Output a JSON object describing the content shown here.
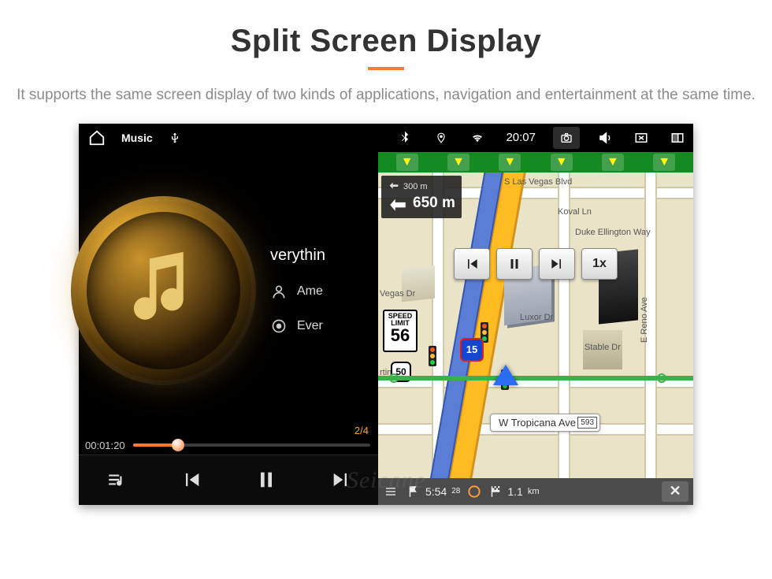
{
  "header": {
    "title": "Split Screen Display",
    "subtitle": "It supports the same screen display of two kinds of applications, navigation and entertainment at the same time."
  },
  "statusbar": {
    "app_title": "Music",
    "time": "20:07",
    "icons": {
      "home": "home-icon",
      "usb": "usb-icon",
      "bluetooth": "bluetooth-icon",
      "location": "location-icon",
      "wifi": "wifi-icon",
      "camera": "camera-icon",
      "volume": "volume-icon",
      "close_app": "close-app-icon",
      "split": "split-screen-icon"
    }
  },
  "music": {
    "track_title": "verythin",
    "artist": "Ame",
    "album": "Ever",
    "track_index": "2/4",
    "elapsed": "00:01:20",
    "controls": {
      "playlist": "♪",
      "prev": "⏮",
      "pause": "⏸",
      "next": "⏭"
    }
  },
  "navigation": {
    "turn_hint": {
      "primary_distance": "650 m",
      "secondary_distance": "300 m"
    },
    "speed_limit": {
      "label": "SPEED LIMIT",
      "value": "56"
    },
    "sim": {
      "prev": "⏮",
      "pause": "⏸",
      "next": "⏭",
      "speed": "1x"
    },
    "streets": {
      "top": "S Las Vegas Blvd",
      "koval": "Koval Ln",
      "duke": "Duke Ellington Way",
      "luxor": "Luxor Dr",
      "stable": "Stable Dr",
      "reno": "E Reno Ave",
      "vegas_dr": "Vegas Dr",
      "martin": "rtin Dr"
    },
    "current_street": {
      "name": "W Tropicana Ave",
      "tag": "593"
    },
    "interstate": "15",
    "bottom": {
      "eta": "5:54",
      "eta_suffix": "28",
      "remaining": "1.1",
      "remaining_unit": "km"
    }
  },
  "interstate_highlight": "50",
  "watermark": "Seicane"
}
